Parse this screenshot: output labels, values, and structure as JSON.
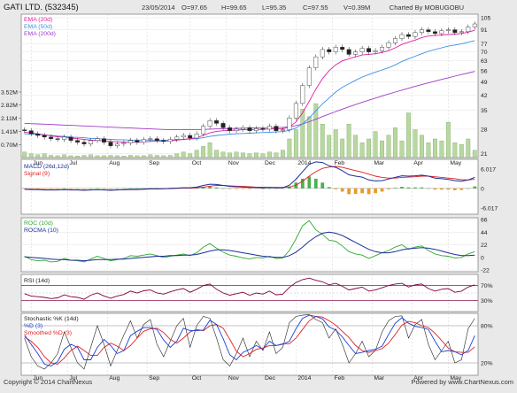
{
  "header": {
    "title": "GATI LTD. (532345)",
    "date": "23/05/2014",
    "open": "O=97.65",
    "high": "H=99.65",
    "low": "L=95.35",
    "close": "C=97.55",
    "volume": "V=0.39M",
    "charted_by": "Charted By MOBUGOBU"
  },
  "footer": {
    "copyright": "Copyright © 2014 ChartNexus",
    "powered_by": "Powered by www.ChartNexus.com"
  },
  "colors": {
    "ema20": "#e0209f",
    "ema50": "#3a8ee6",
    "ema200": "#a03cc8",
    "macd": "#1a2f9a",
    "signal": "#e02020",
    "roc": "#2faa2f",
    "rocma": "#1a2f9a",
    "rsi": "#800040",
    "rsi_band": "#8b1a4a",
    "stoch_k": "#222222",
    "stoch_d": "#1a3fd6",
    "stoch_smoothed": "#e02020",
    "volume_bar": "#b8d8a0",
    "volume_edge": "#6a9a50"
  },
  "chart_data": [
    {
      "type": "candlestick",
      "panel": "price",
      "scale": "log",
      "ylim": [
        20,
        105
      ],
      "right_ticks": [
        "105",
        "91",
        "77",
        "70",
        "63",
        "56",
        "49",
        "42",
        "35",
        "28",
        "21"
      ],
      "right_tick_values": [
        105,
        91,
        77,
        70,
        63,
        56,
        49,
        42,
        35,
        28,
        21
      ],
      "x_labels": [
        "Jun",
        "Jul",
        "Aug",
        "Sep",
        "Oct",
        "Nov",
        "Dec",
        "2014",
        "Feb",
        "Mar",
        "Apr",
        "May"
      ],
      "legend": [
        "EMA (20d)",
        "EMA (50d)",
        "EMA (200d)"
      ],
      "series": [
        {
          "name": "Close",
          "values": [
            27.5,
            26.5,
            26.0,
            25.5,
            25.0,
            24.8,
            25.5,
            24.5,
            24.0,
            23.5,
            24.5,
            25.0,
            24.0,
            23.0,
            23.5,
            23.8,
            24.5,
            24.0,
            24.8,
            25.0,
            24.5,
            24.2,
            24.8,
            25.5,
            26.0,
            25.2,
            26.5,
            29.0,
            31.0,
            30.0,
            28.5,
            27.5,
            28.0,
            28.5,
            27.5,
            28.2,
            28.0,
            29.0,
            27.5,
            27.8,
            32.0,
            38.0,
            47.0,
            58.0,
            66.0,
            72.0,
            70.0,
            74.0,
            72.0,
            68.0,
            70.0,
            73.0,
            70.0,
            71.0,
            74.0,
            78.0,
            82.0,
            86.0,
            84.0,
            88.0,
            91.0,
            89.0,
            87.0,
            90.0,
            91.0,
            88.0,
            89.0,
            94.0,
            97.55
          ]
        },
        {
          "name": "EMA (20d)",
          "values": [
            27.0,
            26.8,
            26.5,
            26.2,
            25.9,
            25.6,
            25.4,
            25.2,
            25.0,
            24.8,
            24.6,
            24.5,
            24.4,
            24.2,
            24.1,
            24.0,
            24.0,
            24.0,
            24.1,
            24.2,
            24.3,
            24.3,
            24.4,
            24.6,
            24.8,
            25.0,
            25.3,
            26.0,
            26.8,
            27.3,
            27.5,
            27.6,
            27.7,
            27.8,
            27.8,
            27.9,
            27.9,
            28.1,
            28.1,
            28.1,
            28.8,
            30.5,
            34.0,
            39.0,
            45.0,
            51.0,
            56.0,
            60.0,
            63.0,
            64.5,
            66.0,
            67.5,
            68.0,
            68.5,
            69.5,
            71.0,
            73.5,
            76.5,
            78.5,
            80.5,
            83.0,
            84.5,
            85.0,
            85.5,
            86.0,
            86.5,
            87.0,
            88.5,
            90.5
          ]
        },
        {
          "name": "EMA (50d)",
          "values": [
            26.5,
            26.4,
            26.3,
            26.1,
            26.0,
            25.8,
            25.7,
            25.5,
            25.4,
            25.3,
            25.1,
            25.0,
            24.9,
            24.8,
            24.7,
            24.7,
            24.6,
            24.6,
            24.6,
            24.6,
            24.6,
            24.6,
            24.6,
            24.7,
            24.8,
            24.9,
            25.0,
            25.3,
            25.7,
            26.0,
            26.2,
            26.4,
            26.5,
            26.6,
            26.7,
            26.8,
            26.9,
            27.0,
            27.1,
            27.2,
            27.6,
            28.4,
            29.8,
            32.0,
            34.8,
            37.8,
            40.5,
            43.5,
            46.0,
            48.0,
            50.0,
            52.0,
            53.5,
            55.0,
            56.5,
            58.0,
            60.0,
            62.5,
            64.5,
            66.5,
            68.5,
            70.5,
            72.0,
            73.5,
            75.0,
            76.0,
            77.0,
            78.5,
            80.0
          ]
        },
        {
          "name": "EMA (200d)",
          "values": [
            30.0,
            29.9,
            29.8,
            29.7,
            29.6,
            29.5,
            29.4,
            29.3,
            29.2,
            29.1,
            29.0,
            28.9,
            28.8,
            28.7,
            28.6,
            28.5,
            28.4,
            28.3,
            28.2,
            28.1,
            28.0,
            27.9,
            27.8,
            27.8,
            27.8,
            27.8,
            27.8,
            27.9,
            28.0,
            28.1,
            28.2,
            28.2,
            28.3,
            28.3,
            28.4,
            28.4,
            28.5,
            28.5,
            28.6,
            28.6,
            28.8,
            29.2,
            29.8,
            30.6,
            31.5,
            32.5,
            33.5,
            34.5,
            35.5,
            36.5,
            37.5,
            38.5,
            39.5,
            40.5,
            41.5,
            42.5,
            43.5,
            44.5,
            45.5,
            46.5,
            47.5,
            48.5,
            49.5,
            50.5,
            51.5,
            52.5,
            53.5,
            54.5,
            55.5
          ]
        }
      ]
    },
    {
      "type": "bar",
      "panel": "volume",
      "ylabel_ticks": [
        "3.52M",
        "2.82M",
        "2.11M",
        "1.41M",
        "0.70M"
      ],
      "tick_values": [
        3.52,
        2.82,
        2.11,
        1.41,
        0.7
      ],
      "series": [
        {
          "name": "Volume",
          "values": [
            0.3,
            0.2,
            0.15,
            0.2,
            0.12,
            0.1,
            0.15,
            0.1,
            0.08,
            0.12,
            0.15,
            0.1,
            0.1,
            0.12,
            0.1,
            0.08,
            0.12,
            0.1,
            0.1,
            0.15,
            0.12,
            0.1,
            0.12,
            0.2,
            0.3,
            0.2,
            0.4,
            0.6,
            0.8,
            0.4,
            0.3,
            0.25,
            0.3,
            0.25,
            0.2,
            0.25,
            0.2,
            0.3,
            0.25,
            0.4,
            1.0,
            1.5,
            2.6,
            2.2,
            2.9,
            1.8,
            1.2,
            1.5,
            1.0,
            1.8,
            1.2,
            0.8,
            1.0,
            1.4,
            0.9,
            1.2,
            1.6,
            0.9,
            2.4,
            1.5,
            1.2,
            0.8,
            1.0,
            0.9,
            1.9,
            0.8,
            0.7,
            1.0,
            0.39
          ]
        }
      ]
    },
    {
      "type": "line",
      "panel": "macd",
      "legend": [
        "MACD (26d,12d)",
        "Signal (9)"
      ],
      "right_ticks": [
        "6.017",
        "0",
        "-6.017"
      ],
      "tick_values": [
        6.017,
        0,
        -6.017
      ],
      "ylim": [
        -8,
        9
      ],
      "series": [
        {
          "name": "MACD (26d,12d)",
          "values": [
            -0.3,
            -0.4,
            -0.4,
            -0.5,
            -0.5,
            -0.5,
            -0.4,
            -0.5,
            -0.5,
            -0.6,
            -0.5,
            -0.4,
            -0.5,
            -0.6,
            -0.5,
            -0.4,
            -0.3,
            -0.3,
            -0.2,
            -0.1,
            -0.1,
            -0.1,
            0.0,
            0.1,
            0.2,
            0.2,
            0.4,
            0.9,
            1.3,
            1.2,
            0.9,
            0.6,
            0.5,
            0.4,
            0.3,
            0.3,
            0.2,
            0.3,
            0.2,
            0.2,
            1.0,
            2.8,
            5.2,
            7.5,
            8.2,
            8.0,
            7.0,
            6.5,
            5.5,
            4.2,
            3.8,
            3.5,
            2.6,
            2.3,
            2.4,
            2.9,
            3.4,
            3.9,
            3.8,
            3.9,
            4.1,
            3.8,
            3.2,
            3.0,
            2.8,
            2.4,
            2.2,
            2.6,
            3.4
          ]
        },
        {
          "name": "Signal (9)",
          "values": [
            -0.2,
            -0.3,
            -0.3,
            -0.4,
            -0.4,
            -0.4,
            -0.4,
            -0.4,
            -0.5,
            -0.5,
            -0.5,
            -0.5,
            -0.5,
            -0.5,
            -0.5,
            -0.5,
            -0.4,
            -0.4,
            -0.3,
            -0.2,
            -0.2,
            -0.1,
            -0.1,
            0.0,
            0.1,
            0.1,
            0.2,
            0.4,
            0.7,
            0.9,
            0.9,
            0.8,
            0.7,
            0.6,
            0.5,
            0.4,
            0.4,
            0.3,
            0.3,
            0.3,
            0.4,
            1.0,
            2.2,
            3.8,
            5.2,
            6.2,
            6.6,
            6.8,
            6.5,
            6.0,
            5.5,
            5.0,
            4.4,
            3.8,
            3.4,
            3.2,
            3.2,
            3.4,
            3.5,
            3.6,
            3.8,
            3.8,
            3.6,
            3.4,
            3.2,
            3.0,
            2.7,
            2.6,
            2.8
          ]
        }
      ]
    },
    {
      "type": "line",
      "panel": "roc",
      "legend": [
        "ROC (10d)",
        "ROCMA (10)"
      ],
      "right_ticks": [
        "66",
        "44",
        "22",
        "0",
        "-22"
      ],
      "tick_values": [
        66,
        44,
        22,
        0,
        -22
      ],
      "ylim": [
        -22,
        66
      ],
      "series": [
        {
          "name": "ROC (10d)",
          "values": [
            2,
            -4,
            -6,
            -5,
            -8,
            -7,
            -2,
            -5,
            -6,
            -8,
            -3,
            2,
            -2,
            -6,
            -4,
            -2,
            3,
            2,
            4,
            6,
            3,
            0,
            2,
            4,
            6,
            3,
            8,
            18,
            24,
            16,
            9,
            4,
            2,
            -1,
            -3,
            0,
            -1,
            2,
            -2,
            -1,
            12,
            32,
            55,
            64,
            48,
            40,
            30,
            28,
            20,
            10,
            6,
            4,
            -2,
            3,
            8,
            12,
            18,
            22,
            14,
            18,
            20,
            12,
            6,
            3,
            2,
            -1,
            0,
            6,
            10
          ]
        },
        {
          "name": "ROCMA (10)",
          "values": [
            1,
            0,
            -1,
            -2,
            -3,
            -4,
            -4,
            -5,
            -5,
            -6,
            -5,
            -4,
            -4,
            -4,
            -3,
            -3,
            -2,
            -1,
            0,
            1,
            2,
            2,
            3,
            3,
            4,
            4,
            5,
            8,
            11,
            13,
            13,
            12,
            10,
            8,
            6,
            4,
            2,
            1,
            0,
            0,
            3,
            9,
            18,
            28,
            36,
            42,
            44,
            42,
            38,
            32,
            26,
            20,
            14,
            10,
            8,
            8,
            10,
            13,
            15,
            16,
            17,
            16,
            14,
            11,
            8,
            5,
            3,
            3,
            4
          ]
        }
      ]
    },
    {
      "type": "line",
      "panel": "rsi",
      "legend": [
        "RSI (14d)"
      ],
      "right_ticks": [
        "70%",
        "30%"
      ],
      "tick_values": [
        70,
        30
      ],
      "ylim": [
        0,
        100
      ],
      "series": [
        {
          "name": "RSI (14d)",
          "values": [
            48,
            42,
            40,
            38,
            35,
            37,
            45,
            40,
            38,
            33,
            44,
            50,
            42,
            36,
            42,
            46,
            55,
            50,
            56,
            58,
            50,
            47,
            53,
            58,
            62,
            52,
            60,
            70,
            74,
            60,
            50,
            44,
            48,
            52,
            44,
            50,
            47,
            55,
            45,
            47,
            65,
            78,
            86,
            90,
            84,
            80,
            72,
            76,
            68,
            58,
            62,
            66,
            55,
            58,
            64,
            70,
            74,
            76,
            66,
            72,
            74,
            62,
            55,
            60,
            62,
            52,
            55,
            66,
            72
          ]
        }
      ]
    },
    {
      "type": "line",
      "panel": "stochastic",
      "legend": [
        "Stochastic %K (14d)",
        "%D (3)",
        "Smoothed %D (3)"
      ],
      "right_ticks": [
        "80%",
        "20%"
      ],
      "tick_values": [
        80,
        20
      ],
      "ylim": [
        0,
        100
      ],
      "series": [
        {
          "name": "Stochastic %K (14d)",
          "values": [
            60,
            30,
            15,
            10,
            20,
            35,
            70,
            45,
            20,
            10,
            45,
            80,
            50,
            15,
            40,
            65,
            88,
            60,
            82,
            90,
            50,
            30,
            55,
            80,
            92,
            45,
            80,
            95,
            92,
            60,
            25,
            15,
            35,
            60,
            30,
            55,
            40,
            70,
            35,
            45,
            85,
            95,
            97,
            98,
            90,
            85,
            60,
            75,
            50,
            20,
            35,
            55,
            30,
            40,
            70,
            88,
            95,
            96,
            60,
            82,
            90,
            50,
            25,
            40,
            55,
            20,
            25,
            75,
            92
          ]
        },
        {
          "name": "%D (3)",
          "values": [
            65,
            50,
            35,
            18,
            15,
            22,
            42,
            50,
            45,
            25,
            25,
            45,
            58,
            48,
            35,
            40,
            64,
            71,
            77,
            77,
            74,
            57,
            45,
            55,
            76,
            72,
            72,
            73,
            89,
            82,
            59,
            33,
            25,
            37,
            42,
            48,
            42,
            55,
            48,
            50,
            55,
            75,
            92,
            97,
            95,
            91,
            78,
            73,
            62,
            48,
            35,
            37,
            40,
            42,
            47,
            66,
            84,
            93,
            84,
            79,
            77,
            74,
            55,
            38,
            40,
            38,
            33,
            40,
            64
          ]
        },
        {
          "name": "Smoothed %D (3)",
          "values": [
            62,
            55,
            45,
            30,
            20,
            18,
            28,
            40,
            47,
            40,
            32,
            32,
            45,
            52,
            47,
            40,
            48,
            60,
            71,
            75,
            76,
            69,
            58,
            52,
            60,
            70,
            74,
            72,
            80,
            82,
            76,
            58,
            39,
            30,
            35,
            42,
            44,
            48,
            48,
            51,
            51,
            60,
            74,
            88,
            95,
            94,
            88,
            81,
            71,
            61,
            48,
            40,
            37,
            40,
            43,
            52,
            66,
            81,
            87,
            85,
            80,
            77,
            68,
            56,
            44,
            38,
            37,
            37,
            46
          ]
        }
      ]
    }
  ]
}
